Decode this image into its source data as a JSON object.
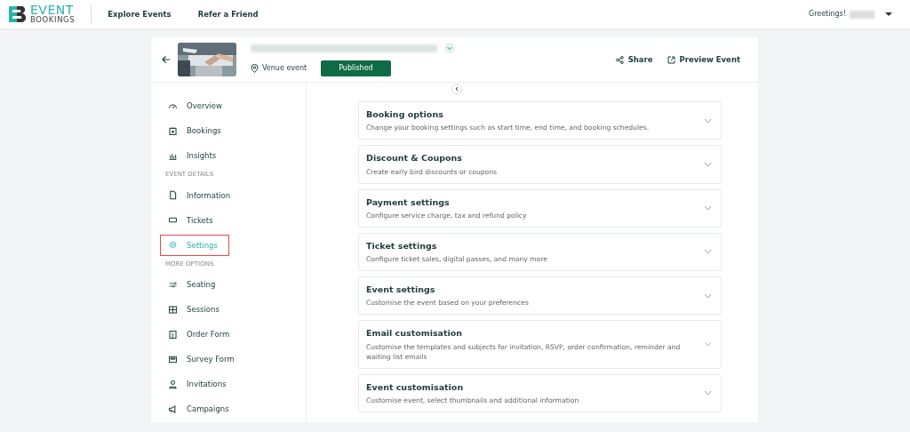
{
  "brand": {
    "line_1": "EVENT",
    "line_2": "BOOKINGS"
  },
  "nav_links": [
    "Explore Events",
    "Refer a Friend"
  ],
  "greeting": "Greetings!",
  "event": {
    "location_type": "Venue event",
    "status": "Published"
  },
  "header_actions": [
    "Share",
    "Preview Event"
  ],
  "sidebar": [
    {
      "items": [
        {
          "label": "Overview",
          "selected": false
        },
        {
          "label": "Bookings",
          "selected": false
        },
        {
          "label": "Insights",
          "selected": false
        }
      ]
    },
    {
      "heading": "EVENT DETAILS",
      "items": [
        {
          "label": "Information",
          "selected": false
        },
        {
          "label": "Tickets",
          "selected": false
        },
        {
          "label": "Settings",
          "selected": true
        }
      ]
    },
    {
      "heading": "MORE OPTIONS",
      "items": [
        {
          "label": "Seating",
          "selected": false
        },
        {
          "label": "Sessions",
          "selected": false
        },
        {
          "label": "Order Form",
          "selected": false
        },
        {
          "label": "Survey Form",
          "selected": false
        },
        {
          "label": "Invitations",
          "selected": false
        },
        {
          "label": "Campaigns",
          "selected": false
        }
      ]
    }
  ],
  "settings_sections": [
    {
      "title": "Booking options",
      "description": "Change your booking settings such as start time, end time, and booking schedules.",
      "expanded": false
    },
    {
      "title": "Discount & Coupons",
      "description": "Create early bird discounts or coupons",
      "expanded": false
    },
    {
      "title": "Payment settings",
      "description": "Configure service charge, tax and refund policy",
      "expanded": false
    },
    {
      "title": "Ticket settings",
      "description": "Configure ticket sales, digital passes, and many more",
      "expanded": false
    },
    {
      "title": "Event settings",
      "description": "Customise the event based on your preferences",
      "expanded": false
    },
    {
      "title": "Email customisation",
      "description": "Customise the templates and subjects for invitation, RSVP, order confirmation, reminder and waiting list emails",
      "expanded": false
    },
    {
      "title": "Event customisation",
      "description": "Customise event, select thumbnails and additional information",
      "expanded": false
    }
  ]
}
